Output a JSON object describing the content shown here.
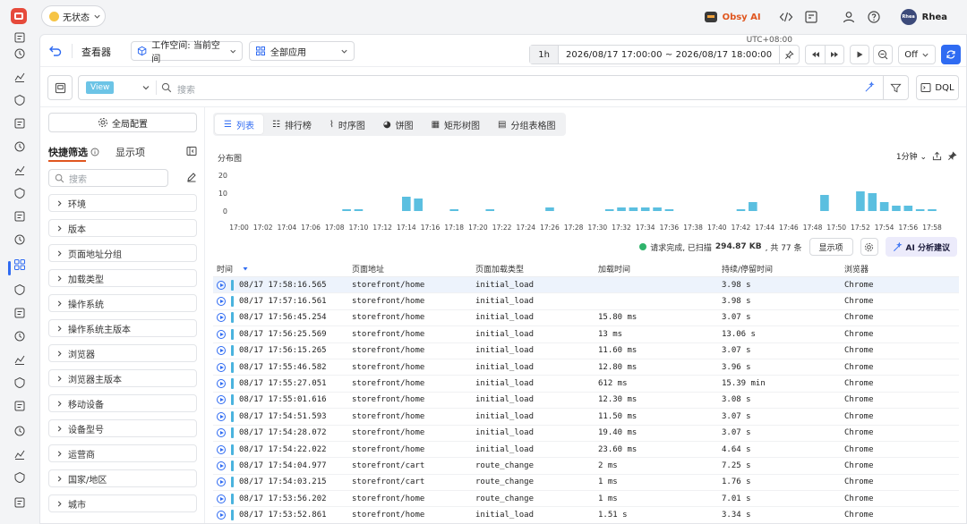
{
  "topbar": {
    "status_label": "无状态",
    "obsy_label": "Obsy AI",
    "user_name": "Rhea",
    "avatar_text": "Rhea"
  },
  "toolbar": {
    "title": "查看器",
    "workspace_label": "工作空间: 当前空间",
    "apps_label": "全部应用",
    "timezone": "UTC+08:00",
    "range_short": "1h",
    "range_text": "2026/08/17 17:00:00 ~ 2026/08/17 18:00:00",
    "refresh_mode": "Off"
  },
  "search": {
    "view_tag": "View",
    "placeholder": "搜索",
    "dql_label": "DQL"
  },
  "sidebar": {
    "global_config": "全局配置",
    "tab_quick_filter": "快捷筛选",
    "tab_display": "显示项",
    "search_placeholder": "搜索",
    "facets": [
      "环境",
      "版本",
      "页面地址分组",
      "加载类型",
      "操作系统",
      "操作系统主版本",
      "浏览器",
      "浏览器主版本",
      "移动设备",
      "设备型号",
      "运营商",
      "国家/地区",
      "城市"
    ]
  },
  "viz_tabs": [
    "列表",
    "排行榜",
    "时序图",
    "饼图",
    "矩形树图",
    "分组表格图"
  ],
  "chart_header": {
    "title": "分布图",
    "interval": "1分钟"
  },
  "chart_data": {
    "type": "bar",
    "title": "分布图",
    "yticks": [
      0,
      10,
      20
    ],
    "ylim": [
      0,
      20
    ],
    "xticks": [
      "17:00",
      "17:02",
      "17:04",
      "17:06",
      "17:08",
      "17:10",
      "17:12",
      "17:14",
      "17:16",
      "17:18",
      "17:20",
      "17:22",
      "17:24",
      "17:26",
      "17:28",
      "17:30",
      "17:32",
      "17:34",
      "17:36",
      "17:38",
      "17:40",
      "17:42",
      "17:44",
      "17:46",
      "17:48",
      "17:50",
      "17:52",
      "17:54",
      "17:56",
      "17:58"
    ],
    "color": "#5bbfe0",
    "categories": [
      "17:09",
      "17:10",
      "17:14",
      "17:15",
      "17:18",
      "17:21",
      "17:26",
      "17:31",
      "17:32",
      "17:33",
      "17:34",
      "17:35",
      "17:36",
      "17:42",
      "17:43",
      "17:49",
      "17:52",
      "17:53",
      "17:54",
      "17:55",
      "17:56",
      "17:57",
      "17:58"
    ],
    "values": [
      1,
      1,
      8,
      7,
      1,
      1,
      2,
      1,
      2,
      2,
      2,
      2,
      1,
      1,
      5,
      9,
      11,
      10,
      5,
      3,
      3,
      1,
      1
    ]
  },
  "result": {
    "status": "请求完成, 已扫描",
    "size": "294.87 KB",
    "count_text": ", 共 77 条",
    "display_btn": "显示项",
    "ai_btn": "AI 分析建议"
  },
  "table": {
    "headers": [
      "时间",
      "页面地址",
      "页面加载类型",
      "加载时间",
      "持续/停留时间",
      "浏览器"
    ],
    "rows": [
      [
        "08/17 17:58:16.565",
        "storefront/home",
        "initial_load",
        "",
        "3.98 s",
        "Chrome"
      ],
      [
        "08/17 17:57:16.561",
        "storefront/home",
        "initial_load",
        "",
        "3.98 s",
        "Chrome"
      ],
      [
        "08/17 17:56:45.254",
        "storefront/home",
        "initial_load",
        "15.80 ms",
        "3.07 s",
        "Chrome"
      ],
      [
        "08/17 17:56:25.569",
        "storefront/home",
        "initial_load",
        "13 ms",
        "13.06 s",
        "Chrome"
      ],
      [
        "08/17 17:56:15.265",
        "storefront/home",
        "initial_load",
        "11.60 ms",
        "3.07 s",
        "Chrome"
      ],
      [
        "08/17 17:55:46.582",
        "storefront/home",
        "initial_load",
        "12.80 ms",
        "3.96 s",
        "Chrome"
      ],
      [
        "08/17 17:55:27.051",
        "storefront/home",
        "initial_load",
        "612 ms",
        "15.39 min",
        "Chrome"
      ],
      [
        "08/17 17:55:01.616",
        "storefront/home",
        "initial_load",
        "12.30 ms",
        "3.08 s",
        "Chrome"
      ],
      [
        "08/17 17:54:51.593",
        "storefront/home",
        "initial_load",
        "11.50 ms",
        "3.07 s",
        "Chrome"
      ],
      [
        "08/17 17:54:28.072",
        "storefront/home",
        "initial_load",
        "19.40 ms",
        "3.07 s",
        "Chrome"
      ],
      [
        "08/17 17:54:22.022",
        "storefront/home",
        "initial_load",
        "23.60 ms",
        "4.64 s",
        "Chrome"
      ],
      [
        "08/17 17:54:04.977",
        "storefront/cart",
        "route_change",
        "2 ms",
        "7.25 s",
        "Chrome"
      ],
      [
        "08/17 17:54:03.215",
        "storefront/cart",
        "route_change",
        "1 ms",
        "1.76 s",
        "Chrome"
      ],
      [
        "08/17 17:53:56.202",
        "storefront/home",
        "route_change",
        "1 ms",
        "7.01 s",
        "Chrome"
      ],
      [
        "08/17 17:53:52.861",
        "storefront/home",
        "initial_load",
        "1.51 s",
        "3.34 s",
        "Chrome"
      ]
    ]
  }
}
